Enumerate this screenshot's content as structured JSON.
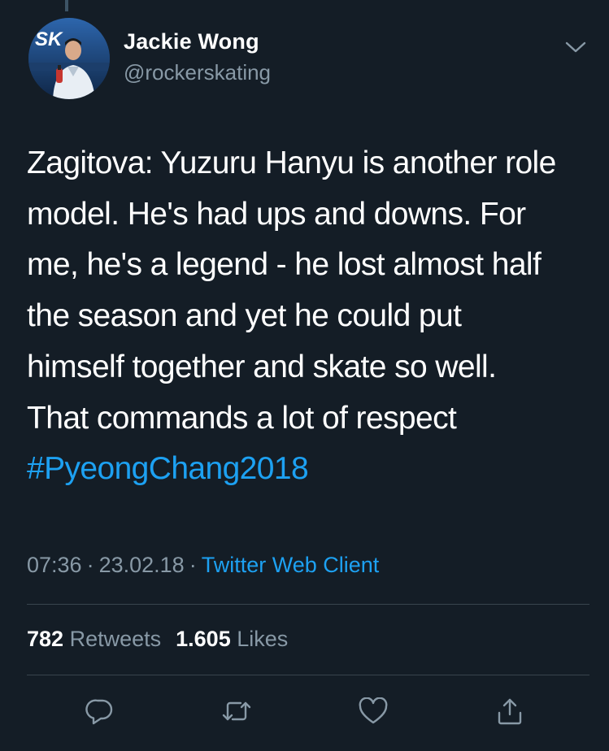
{
  "tweet": {
    "author": {
      "name": "Jackie Wong",
      "handle": "@rockerskating",
      "avatar_logo": "SK"
    },
    "text_lines": [
      "Zagitova: Yuzuru Hanyu is another role",
      "model. He's had ups and downs. For",
      "me, he's a legend - he lost almost half",
      "the season and yet he could put",
      "himself together and skate so well.",
      "That commands a lot of respect"
    ],
    "hashtag": "#PyeongChang2018",
    "time": "07:36",
    "date": "23.02.18",
    "separator": "·",
    "client": "Twitter Web Client",
    "retweets_count": "782",
    "retweets_label": "Retweets",
    "likes_count": "1.605",
    "likes_label": "Likes"
  },
  "icons": {
    "menu": "chevron-down-icon",
    "reply": "reply-icon",
    "retweet": "retweet-icon",
    "like": "heart-icon",
    "share": "share-icon"
  },
  "colors": {
    "background": "#141d26",
    "text": "#ffffff",
    "secondary": "#8899a6",
    "link": "#1da1f2",
    "divider": "#38444d"
  }
}
